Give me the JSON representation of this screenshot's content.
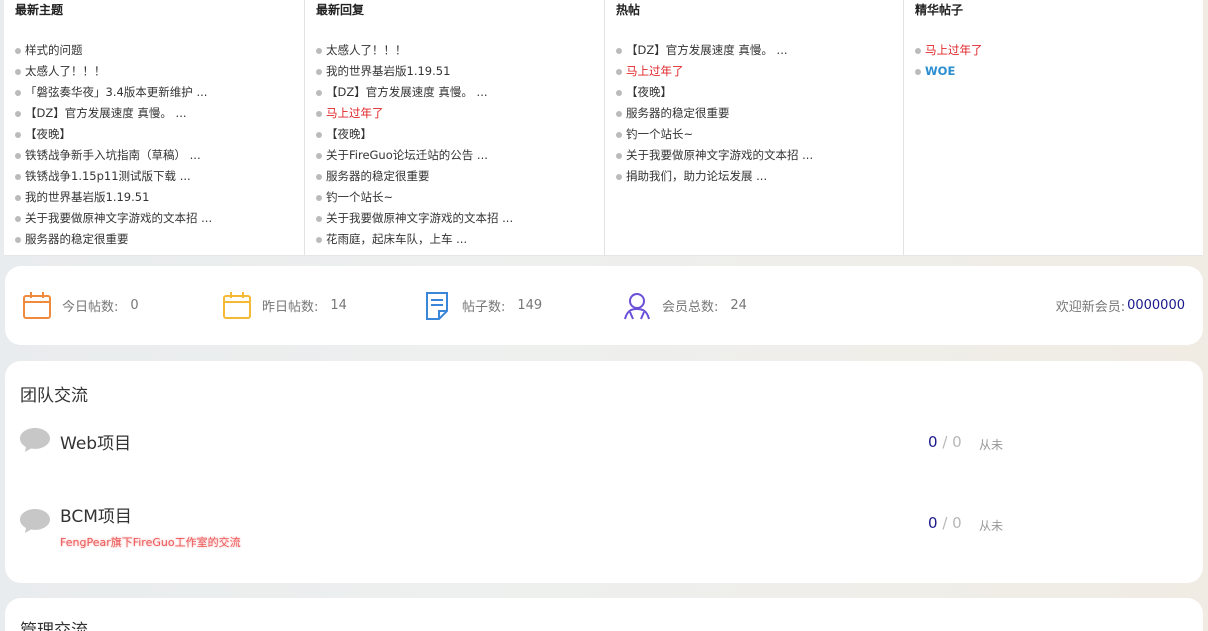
{
  "panels": [
    {
      "title": "最新主题",
      "items": [
        {
          "text": "样式的问题",
          "style": ""
        },
        {
          "text": "太感人了！！！",
          "style": ""
        },
        {
          "text": "「磐弦奏华夜」3.4版本更新维护 ...",
          "style": ""
        },
        {
          "text": "【DZ】官方发展速度 真慢。 ...",
          "style": ""
        },
        {
          "text": "【夜晚】",
          "style": ""
        },
        {
          "text": "铁锈战争新手入坑指南（草稿） ...",
          "style": ""
        },
        {
          "text": "铁锈战争1.15p11测试版下载 ...",
          "style": ""
        },
        {
          "text": "我的世界基岩版1.19.51",
          "style": ""
        },
        {
          "text": "关于我要做原神文字游戏的文本招 ...",
          "style": ""
        },
        {
          "text": "服务器的稳定很重要",
          "style": ""
        }
      ]
    },
    {
      "title": "最新回复",
      "items": [
        {
          "text": "太感人了！！！",
          "style": ""
        },
        {
          "text": "我的世界基岩版1.19.51",
          "style": ""
        },
        {
          "text": "【DZ】官方发展速度 真慢。 ...",
          "style": ""
        },
        {
          "text": "马上过年了",
          "style": "red"
        },
        {
          "text": "【夜晚】",
          "style": ""
        },
        {
          "text": "关于FireGuo论坛迁站的公告 ...",
          "style": ""
        },
        {
          "text": "服务器的稳定很重要",
          "style": ""
        },
        {
          "text": "钓一个站长~",
          "style": ""
        },
        {
          "text": "关于我要做原神文字游戏的文本招 ...",
          "style": ""
        },
        {
          "text": "花雨庭，起床车队，上车 ...",
          "style": ""
        }
      ]
    },
    {
      "title": "热帖",
      "items": [
        {
          "text": "【DZ】官方发展速度 真慢。 ...",
          "style": ""
        },
        {
          "text": "马上过年了",
          "style": "red"
        },
        {
          "text": "【夜晚】",
          "style": ""
        },
        {
          "text": "服务器的稳定很重要",
          "style": ""
        },
        {
          "text": "钓一个站长~",
          "style": ""
        },
        {
          "text": "关于我要做原神文字游戏的文本招 ...",
          "style": ""
        },
        {
          "text": "捐助我们，助力论坛发展 ...",
          "style": ""
        }
      ]
    },
    {
      "title": "精华帖子",
      "items": [
        {
          "text": "马上过年了",
          "style": "red"
        },
        {
          "text": "WOE",
          "style": "blue"
        }
      ]
    }
  ],
  "stats": {
    "today_label": "今日帖数:",
    "today_value": "0",
    "yesterday_label": "昨日帖数:",
    "yesterday_value": "14",
    "posts_label": "帖子数:",
    "posts_value": "149",
    "members_label": "会员总数:",
    "members_value": "24",
    "welcome_label": "欢迎新会员:",
    "welcome_name": "0000000"
  },
  "colors": {
    "orange": "#f08a3c",
    "yellow": "#f5b935",
    "blue": "#3a86d8",
    "purple": "#6a4fd8",
    "accent_name": "#1a1a8c"
  },
  "group1": {
    "title": "团队交流",
    "forums": [
      {
        "name": "Web项目",
        "desc": "",
        "threads": "0",
        "posts": "0",
        "last": "从未"
      },
      {
        "name": "BCM项目",
        "desc": "FengPear旗下FireGuo工作室的交流",
        "threads": "0",
        "posts": "0",
        "last": "从未"
      }
    ]
  },
  "group2": {
    "title": "管理交流"
  },
  "separator": "/"
}
